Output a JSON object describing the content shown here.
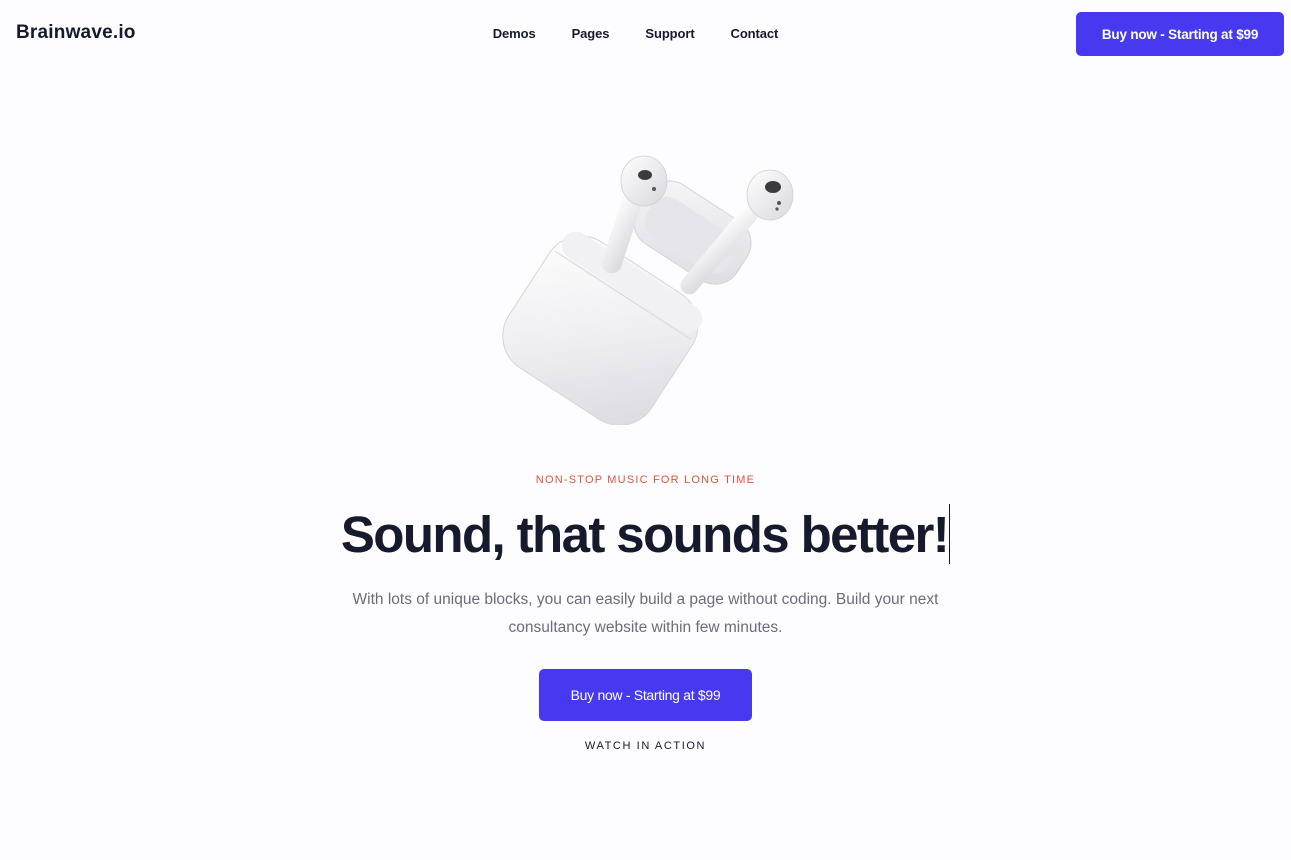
{
  "header": {
    "logo": "Brainwave.io",
    "nav": [
      {
        "label": "Demos"
      },
      {
        "label": "Pages"
      },
      {
        "label": "Support"
      },
      {
        "label": "Contact"
      }
    ],
    "cta_label": "Buy now - Starting at $99"
  },
  "hero": {
    "image_icon": "airpods-illustration",
    "eyebrow": "NON-STOP MUSIC FOR LONG TIME",
    "headline": "Sound, that sounds better!",
    "description": "With lots of unique blocks, you can easily build a page without coding. Build your next consultancy website within few minutes.",
    "cta_label": "Buy now - Starting at $99",
    "secondary_link": "WATCH IN ACTION"
  },
  "colors": {
    "accent": "#4739f0",
    "eyebrow": "#e0543f",
    "text_dark": "#161a2d",
    "text_muted": "#6a6d7c",
    "background": "#fdfcfe"
  }
}
